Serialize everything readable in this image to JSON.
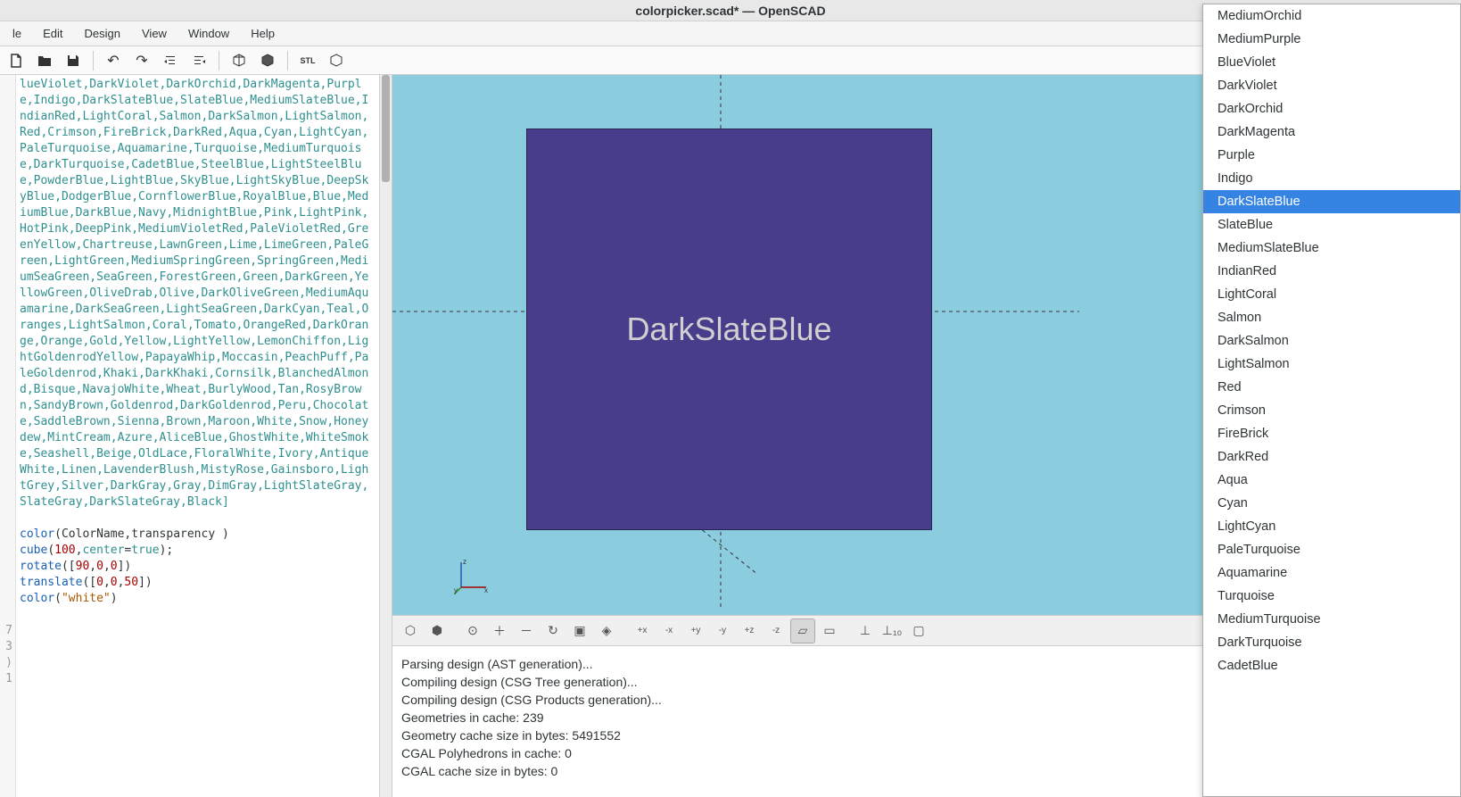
{
  "window": {
    "title": "colorpicker.scad* — OpenSCAD"
  },
  "menu": [
    "le",
    "Edit",
    "Design",
    "View",
    "Window",
    "Help"
  ],
  "gutter": [
    "",
    "",
    "",
    "",
    "",
    "",
    "",
    "",
    "",
    "",
    "",
    "",
    "",
    "",
    "",
    "",
    "",
    "",
    "",
    "",
    "",
    "",
    "",
    "",
    "",
    "",
    "",
    "",
    "",
    "",
    "",
    "",
    "",
    "",
    "7",
    "3",
    ")",
    "1"
  ],
  "viewport": {
    "label": "DarkSlateBlue",
    "axes": {
      "x": "x",
      "y": "y",
      "z": "z"
    }
  },
  "console": {
    "lines": [
      "Parsing design (AST generation)...",
      "Compiling design (CSG Tree generation)...",
      "Compiling design (CSG Products generation)...",
      "Geometries in cache: 239",
      "Geometry cache size in bytes: 5491552",
      "CGAL Polyhedrons in cache: 0",
      "CGAL cache size in bytes: 0"
    ]
  },
  "dropdown": {
    "selected": "DarkSlateBlue",
    "items": [
      "MediumOrchid",
      "MediumPurple",
      "BlueViolet",
      "DarkViolet",
      "DarkOrchid",
      "DarkMagenta",
      "Purple",
      "Indigo",
      "DarkSlateBlue",
      "SlateBlue",
      "MediumSlateBlue",
      "IndianRed",
      "LightCoral",
      "Salmon",
      "DarkSalmon",
      "LightSalmon",
      "Red",
      "Crimson",
      "FireBrick",
      "DarkRed",
      "Aqua",
      "Cyan",
      "LightCyan",
      "PaleTurquoise",
      "Aquamarine",
      "Turquoise",
      "MediumTurquoise",
      "DarkTurquoise",
      "CadetBlue"
    ]
  },
  "code_colors": "lueViolet,DarkViolet,DarkOrchid,DarkMagenta,Purple,Indigo,DarkSlateBlue,SlateBlue,MediumSlateBlue,IndianRed,LightCoral,Salmon,DarkSalmon,LightSalmon,Red,Crimson,FireBrick,DarkRed,Aqua,Cyan,LightCyan,PaleTurquoise,Aquamarine,Turquoise,MediumTurquoise,DarkTurquoise,CadetBlue,SteelBlue,LightSteelBlue,PowderBlue,LightBlue,SkyBlue,LightSkyBlue,DeepSkyBlue,DodgerBlue,CornflowerBlue,RoyalBlue,Blue,MediumBlue,DarkBlue,Navy,MidnightBlue,Pink,LightPink,HotPink,DeepPink,MediumVioletRed,PaleVioletRed,GreenYellow,Chartreuse,LawnGreen,Lime,LimeGreen,PaleGreen,LightGreen,MediumSpringGreen,SpringGreen,MediumSeaGreen,SeaGreen,ForestGreen,Green,DarkGreen,YellowGreen,OliveDrab,Olive,DarkOliveGreen,MediumAquamarine,DarkSeaGreen,LightSeaGreen,DarkCyan,Teal,Oranges,LightSalmon,Coral,Tomato,OrangeRed,DarkOrange,Orange,Gold,Yellow,LightYellow,LemonChiffon,LightGoldenrodYellow,PapayaWhip,Moccasin,PeachPuff,PaleGoldenrod,Khaki,DarkKhaki,Cornsilk,BlanchedAlmond,Bisque,NavajoWhite,Wheat,BurlyWood,Tan,RosyBrown,SandyBrown,Goldenrod,DarkGoldenrod,Peru,Chocolate,SaddleBrown,Sienna,Brown,Maroon,White,Snow,Honeydew,MintCream,Azure,AliceBlue,GhostWhite,WhiteSmoke,Seashell,Beige,OldLace,FloralWhite,Ivory,AntiqueWhite,Linen,LavenderBlush,MistyRose,Gainsboro,LightGrey,Silver,DarkGray,Gray,DimGray,LightSlateGray,SlateGray,DarkSlateGray,Black",
  "code_tail": {
    "l1a": "color",
    "l1b": "(ColorName,transparency )",
    "l2a": "cube",
    "l2b": "(",
    "l2c": "100",
    "l2d": ",",
    "l2e": "center",
    "l2f": "=",
    "l2g": "true",
    "l2h": ");",
    "l3a": "rotate",
    "l3b": "([",
    "l3c": "90",
    "l3d": ",",
    "l3e": "0",
    "l3f": ",",
    "l3g": "0",
    "l3h": "])",
    "l4a": "translate",
    "l4b": "([",
    "l4c": "0",
    "l4d": ",",
    "l4e": "0",
    "l4f": ",",
    "l4g": "50",
    "l4h": "])",
    "l5a": "color",
    "l5b": "(",
    "l5c": "\"white\"",
    "l5d": ")"
  }
}
